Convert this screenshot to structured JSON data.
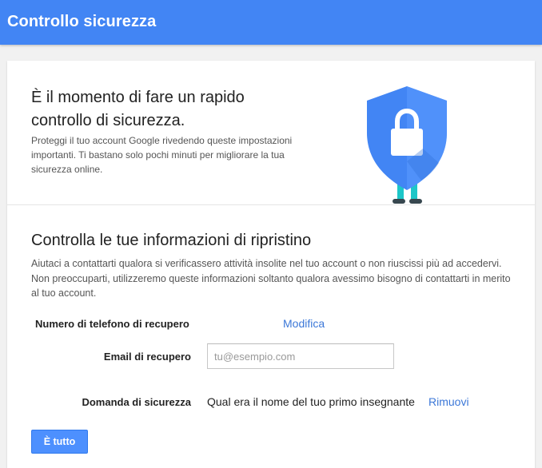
{
  "header": {
    "title": "Controllo sicurezza",
    "background_color": "#4285f4"
  },
  "intro": {
    "heading": "È il momento di fare un rapido controllo di sicurezza.",
    "description": "Proteggi il tuo account Google rivedendo queste impostazioni importanti. Ti bastano solo pochi minuti per migliorare la tua sicurezza online.",
    "illustration_icon": "shield-lock-icon"
  },
  "recovery": {
    "heading": "Controlla le tue informazioni di ripristino",
    "description": "Aiutaci a contattarti qualora si verificassero attività insolite nel tuo account o non riuscissi più ad accedervi. Non preoccuparti, utilizzeremo queste informazioni soltanto qualora avessimo bisogno di contattarti in merito al tuo account.",
    "phone": {
      "label": "Numero di telefono di recupero",
      "action_label": "Modifica"
    },
    "email": {
      "label": "Email di recupero",
      "value": "",
      "placeholder": "tu@esempio.com"
    },
    "security_question": {
      "label": "Domanda di sicurezza",
      "value": "Qual era il nome del tuo primo insegnante",
      "action_label": "Rimuovi"
    },
    "done_label": "È tutto"
  },
  "colors": {
    "link": "#3c78d8",
    "button": "#4d90fe",
    "shield": "#4285f4"
  }
}
